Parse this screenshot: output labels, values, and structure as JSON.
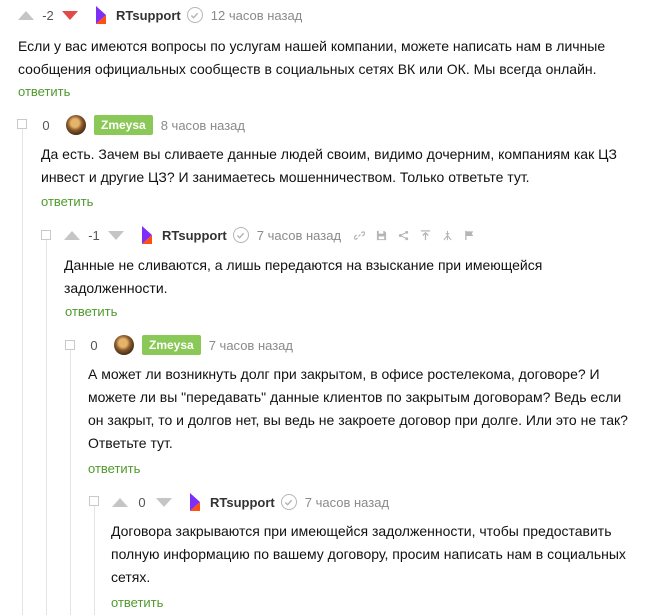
{
  "comments": [
    {
      "rating": "-2",
      "author": "RTsupport",
      "time": "12 часов назад",
      "text_lines": [
        "Если у вас имеются вопросы по услугам нашей компании, можете написать нам в личные",
        "сообщения официальных сообществ в социальных сетях ВК или ОК. Мы всегда онлайн."
      ],
      "reply_label": "ответить"
    },
    {
      "rating": "0",
      "author": "Zmeysa",
      "time": "8 часов назад",
      "text_lines": [
        "Да есть. Зачем вы сливаете данные людей своим, видимо дочерним, компаниям как ЦЗ",
        "инвест и другие ЦЗ? И занимаетесь мошенничеством. Только ответьте тут."
      ],
      "reply_label": "ответить"
    },
    {
      "rating": "-1",
      "author": "RTsupport",
      "time": "7 часов назад",
      "text_lines": [
        "Данные не сливаются, а лишь передаются на взыскание при имеющейся",
        "задолженности."
      ],
      "reply_label": "ответить"
    },
    {
      "rating": "0",
      "author": "Zmeysa",
      "time": "7 часов назад",
      "text_lines": [
        "А может ли возникнуть долг при закрытом, в офисе ростелекома, договоре? И",
        "можете ли вы \"передавать\" данные клиентов по закрытым договорам? Ведь если",
        "он закрыт, то и долгов нет, вы ведь не закроете договор при долге. Или это не так?",
        "Ответьте тут."
      ],
      "reply_label": "ответить"
    },
    {
      "rating": "0",
      "author": "RTsupport",
      "time": "7 часов назад",
      "text_lines": [
        "Договора закрываются при имеющейся задолженности, чтобы предоставить",
        "полную информацию по вашему договору, просим написать нам в социальных",
        "сетях."
      ],
      "reply_label": "ответить"
    }
  ],
  "colors": {
    "brand_purple": "#7b2ff7",
    "brand_orange": "#ff4f12",
    "user_badge": "#8ac858",
    "reply_link": "#4f9a2d",
    "downvote_active": "#e24a4a"
  },
  "icons": [
    "rostelecom-logo-icon",
    "verified-icon",
    "link-icon",
    "save-icon",
    "share-icon",
    "pin-icon",
    "thumbs-icon",
    "flag-icon"
  ]
}
